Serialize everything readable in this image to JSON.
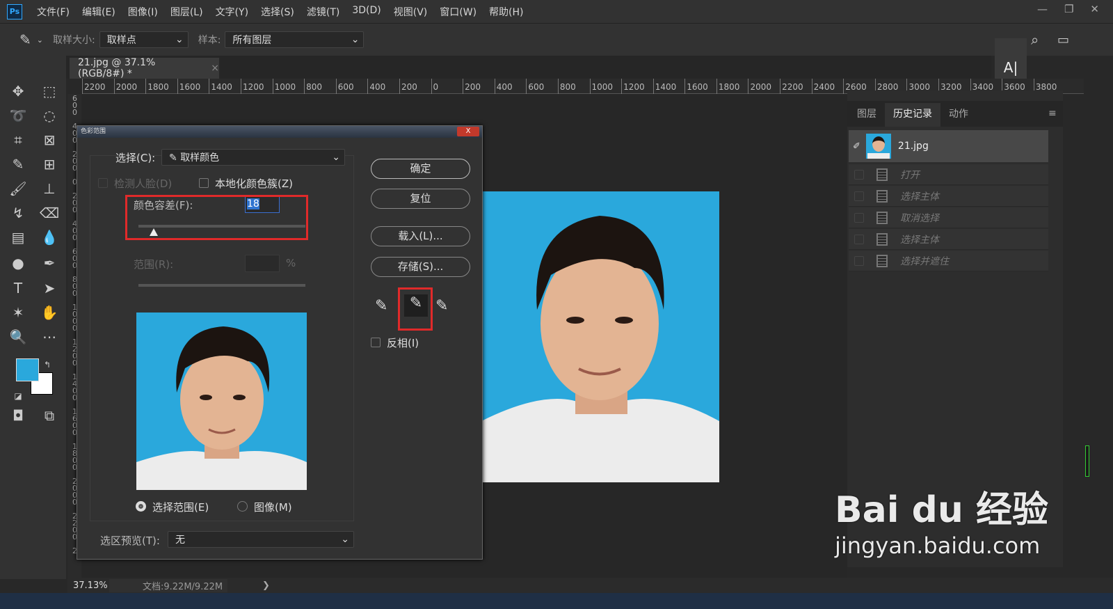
{
  "app": {
    "logo": "Ps",
    "menu": [
      "文件(F)",
      "编辑(E)",
      "图像(I)",
      "图层(L)",
      "文字(Y)",
      "选择(S)",
      "滤镜(T)",
      "3D(D)",
      "视图(V)",
      "窗口(W)",
      "帮助(H)"
    ],
    "window_controls": [
      "—",
      "❐",
      "✕"
    ]
  },
  "options": {
    "sample_size_label": "取样大小:",
    "sample_size_value": "取样点",
    "sample_label": "样本:",
    "sample_value": "所有图层"
  },
  "document_tab": {
    "title": "21.jpg @ 37.1%(RGB/8#) *",
    "close": "×"
  },
  "ruler": {
    "h_labels": [
      "2200",
      "2000",
      "1800",
      "1600",
      "1400",
      "1200",
      "1000",
      "800",
      "600",
      "400",
      "200",
      "0",
      "200",
      "400",
      "600",
      "800",
      "1000",
      "1200",
      "1400",
      "1600",
      "1800",
      "2000",
      "2200",
      "2400",
      "2600",
      "2800",
      "3000",
      "3200",
      "3400",
      "3600",
      "3800"
    ],
    "v_labels": "600 400 200 0 200 400 600 800 1000 1200 1400 1600 1800 2000 2200 2"
  },
  "colors": {
    "foreground": "#2aa8dc",
    "background": "#ffffff",
    "accent_red": "#e02a2a",
    "photo_bg": "#2aa8dc"
  },
  "dialog": {
    "title": "色彩范围",
    "close": "X",
    "select_label": "选择(C):",
    "select_value": "取样颜色",
    "detect_faces": "检测人脸(D)",
    "localized": "本地化颜色簇(Z)",
    "fuzziness_label": "颜色容差(F):",
    "fuzziness_value": "18",
    "fuzziness_fraction": 0.09,
    "range_label": "范围(R):",
    "range_unit": "%",
    "radio_selection": "选择范围(E)",
    "radio_image": "图像(M)",
    "preview_label": "选区预览(T):",
    "preview_value": "无",
    "buttons": {
      "ok": "确定",
      "reset": "复位",
      "load": "载入(L)...",
      "save": "存储(S)..."
    },
    "invert": "反相(I)"
  },
  "panel": {
    "tabs": [
      "图层",
      "历史记录",
      "动作"
    ],
    "active_tab": "历史记录",
    "snapshot": "21.jpg",
    "history": [
      "打开",
      "选择主体",
      "取消选择",
      "选择主体",
      "选择并遮住"
    ]
  },
  "text_tool_label": "A|",
  "status": {
    "zoom": "37.13%",
    "doc": "文档:9.22M/9.22M",
    "arrow": "❯"
  },
  "watermark": {
    "brand": "Bai du 经验",
    "url": "jingyan.baidu.com"
  }
}
